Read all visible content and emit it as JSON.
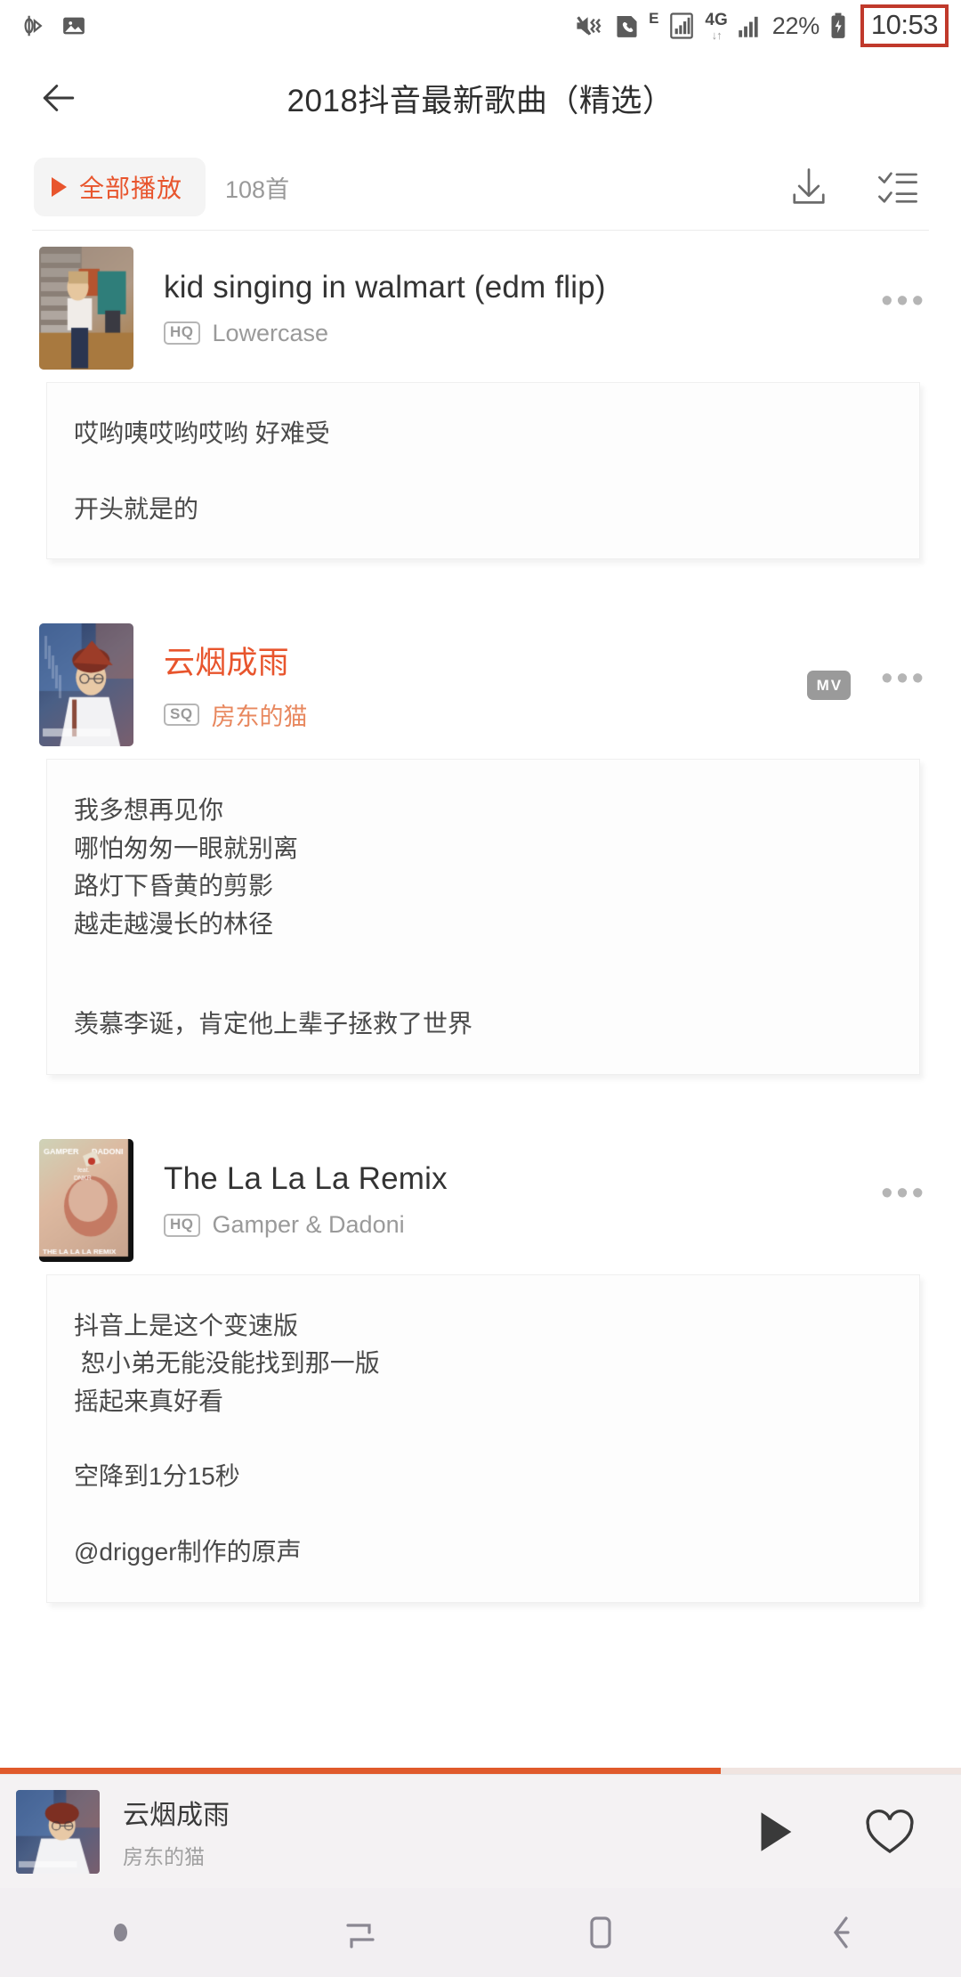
{
  "status_bar": {
    "left_icons": [
      "nfc-icon",
      "screenshot-image-icon"
    ],
    "right_icons": [
      "mute-vibrate-icon",
      "call-sim-icon",
      "network-e-icon",
      "signal-bars-icon",
      "4g-data-icon",
      "signal-bars-2-icon",
      "battery-charging-icon"
    ],
    "network_label": "E",
    "data_label": "4G",
    "battery_percent": "22%",
    "time": "10:53",
    "time_highlight_color": "#c0392b"
  },
  "header": {
    "back_icon": "arrow-left-icon",
    "title": "2018抖音最新歌曲（精选）"
  },
  "action_bar": {
    "play_all_label": "全部播放",
    "play_icon": "play-triangle-icon",
    "song_count": "108首",
    "download_icon": "download-icon",
    "multiselect_icon": "checklist-icon",
    "accent_color": "#e8552d"
  },
  "songs": [
    {
      "title": "kid singing in walmart (edm flip)",
      "artist": "Lowercase",
      "quality_badge": "HQ",
      "has_mv": false,
      "is_playing": false,
      "more_icon": "more-horizontal-icon",
      "comment_lines": [
        "哎哟咦哎哟哎哟 好难受",
        "",
        "开头就是的"
      ]
    },
    {
      "title": "云烟成雨",
      "artist": "房东的猫",
      "quality_badge": "SQ",
      "has_mv": true,
      "mv_badge": "MV",
      "is_playing": true,
      "more_icon": "more-horizontal-icon",
      "comment_lines": [
        "我多想再见你",
        "哪怕匆匆一眼就别离",
        "路灯下昏黄的剪影",
        "越走越漫长的林径",
        "",
        "羡慕李诞，肯定他上辈子拯救了世界"
      ]
    },
    {
      "title": "The La La La Remix",
      "artist": "Gamper & Dadoni",
      "quality_badge": "HQ",
      "has_mv": false,
      "is_playing": false,
      "more_icon": "more-horizontal-icon",
      "comment_lines": [
        "抖音上是这个变速版",
        " 恕小弟无能没能找到那一版",
        "摇起来真好看",
        "",
        "空降到1分15秒",
        "",
        "@drigger制作的原声"
      ]
    }
  ],
  "progress": {
    "percent": 75,
    "fill_color": "#e05a2b",
    "track_color": "#f0e4e0"
  },
  "player": {
    "title": "云烟成雨",
    "artist": "房东的猫",
    "play_icon": "play-icon",
    "like_icon": "heart-outline-icon"
  },
  "nav_bar": {
    "items": [
      "dot-indicator",
      "recents-icon",
      "home-icon",
      "back-icon"
    ]
  }
}
